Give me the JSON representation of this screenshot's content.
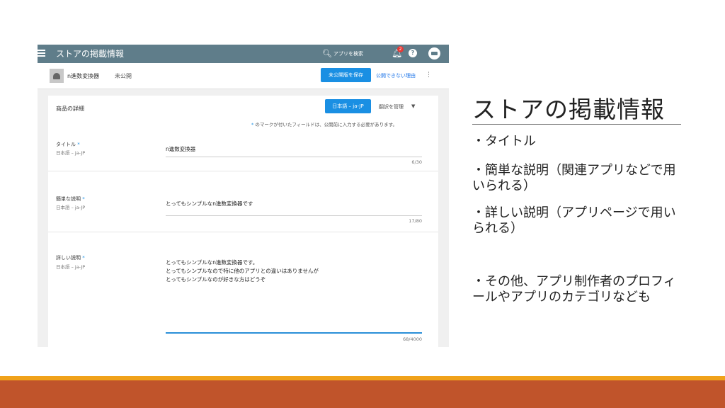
{
  "topbar": {
    "title": "ストアの掲載情報",
    "search_label": "アプリを検索",
    "notification_count": "2",
    "help_label": "?"
  },
  "app": {
    "name": "n進数変換器",
    "status": "未公開",
    "save_button": "未公開版を保存",
    "why_link": "公開できない理由",
    "more": "⋮"
  },
  "details": {
    "section_title": "商品の詳細",
    "language_button": "日本語 – ja-JP",
    "translate_label": "翻訳を管理",
    "required_note_star": "*",
    "required_note": " のマークが付いたフィールドは、公開前に入力する必要があります。",
    "fields": [
      {
        "label": "タイトル",
        "star": "*",
        "locale": "日本語 – ja-JP",
        "value": "n進数変換器",
        "count": "6/30"
      },
      {
        "label": "簡単な説明",
        "star": "*",
        "locale": "日本語 – ja-JP",
        "value": "とってもシンプルなn進数変換器です",
        "count": "17/80"
      },
      {
        "label": "詳しい説明",
        "star": "*",
        "locale": "日本語 – ja-JP",
        "value": "とってもシンプルなn進数変換器です。\nとってもシンプルなので特に他のアプリとの違いはありませんが\nとってもシンプルなのが好きな方はどうぞ",
        "count": "68/4000"
      }
    ]
  },
  "slide": {
    "title": "ストアの掲載情報",
    "bullets": [
      "・タイトル",
      "・簡単な説明（関連アプリなどで用いられる）",
      "・詳しい説明（アプリページで用いられる）",
      "・その他、アプリ制作者のプロフィールやアプリのカテゴリなども"
    ]
  },
  "colors": {
    "topbar": "#5f7d8a",
    "primary_button": "#1a8fe3",
    "footer_orange": "#f0a21a",
    "footer_red": "#c0542b"
  }
}
